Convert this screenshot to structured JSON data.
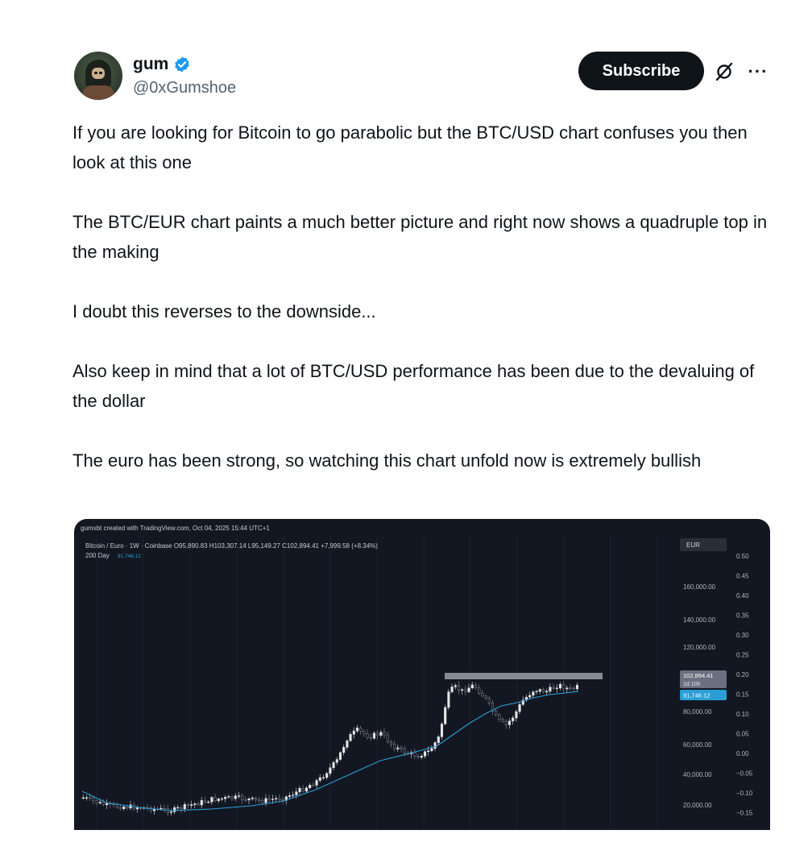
{
  "author": {
    "display_name": "gum",
    "handle": "@0xGumshoe",
    "avatar_icon": "hooded-figure-avatar",
    "verified_icon": "verified-badge-icon",
    "verified_color": "#1d9bf0"
  },
  "actions": {
    "subscribe_label": "Subscribe",
    "grok_icon": "grok-icon",
    "more_icon": "more-icon",
    "more_label": "···"
  },
  "post": {
    "paragraphs": [
      "If you are looking for Bitcoin to go parabolic but the BTC/USD chart confuses you then look at this one",
      "The BTC/EUR chart paints a much better picture and right now shows a quadruple top in the making",
      "I doubt this reverses to the downside...",
      "Also keep in mind that a lot of BTC/USD performance has been due to the devaluing of the dollar",
      "The euro has been strong, so watching this chart unfold now is extremely bullish"
    ]
  },
  "chart_image": {
    "header": "gumxbt created with TradingView.com, Oct 04, 2025 15:44 UTC+1",
    "symbol_line": "Bitcoin / Euro · 1W · Coinbase  O95,890.83  H103,307.14  L95,149.27  C102,894.41  +7,999.58 (+8.34%)",
    "ma_label": "200 Day",
    "ma_value": "91,746.12",
    "currency": "EUR",
    "price_label": "102,894.41",
    "countdown": "1d 10h",
    "ma_price_label": "91,746.12",
    "price_ticks": [
      "160,000.00",
      "140,000.00",
      "120,000.00",
      "80,000.00",
      "60,000.00",
      "40,000.00",
      "20,000.00"
    ],
    "right_ticks": [
      "0.50",
      "0.45",
      "0.40",
      "0.35",
      "0.30",
      "0.25",
      "0.20",
      "0.15",
      "0.10",
      "0.05",
      "0.00",
      "−0.05",
      "−0.10",
      "−0.15"
    ],
    "colors": {
      "background": "#131722",
      "up": "#e6e6e6",
      "down": "#8a8f9a",
      "ma_line": "#2a9fd6",
      "resistance_band": "#9aa0a8",
      "ma_badge": "#2a9fd6"
    }
  }
}
